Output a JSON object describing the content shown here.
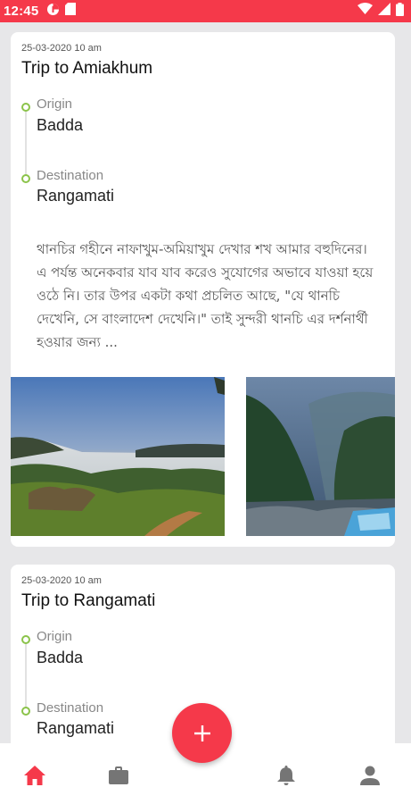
{
  "status_bar": {
    "time": "12:45",
    "left_icons": [
      "data-saver-icon",
      "sd-card-icon"
    ],
    "right_icons": [
      "wifi-icon",
      "signal-icon",
      "battery-icon"
    ],
    "color": "#f5394a"
  },
  "trips": [
    {
      "date": "25-03-2020 10 am",
      "title": "Trip to Amiakhum",
      "origin_label": "Origin",
      "origin": "Badda",
      "destination_label": "Destination",
      "destination": "Rangamati",
      "description": "থানচির গহীনে নাফাখুম-অমিয়াখুম দেখার শখ আমার বহুদিনের। এ পর্যন্ত অনেকবার যাব যাব করেও সুযোগের অভাবে যাওয়া হয়ে ওঠে নি। তার উপর একটা কথা প্রচলিত আছে, \"যে থানচি দেখেনি, সে বাংলাদেশ দেখেনি।\" তাই সুন্দরী থানচি এর দর্শনার্থী হওয়ার জন্য ...",
      "photos": [
        "sunrise-hills-photo",
        "waterfall-forest-photo"
      ]
    },
    {
      "date": "25-03-2020 10 am",
      "title": "Trip to Rangamati",
      "origin_label": "Origin",
      "origin": "Badda",
      "destination_label": "Destination",
      "destination": "Rangamati"
    }
  ],
  "bottom_nav": {
    "items": [
      "home-icon",
      "briefcase-icon",
      "bell-icon",
      "profile-icon"
    ],
    "active": "home-icon",
    "active_color": "#f5394a",
    "inactive_color": "#757575",
    "fab_icon": "plus-icon"
  },
  "timeline_dot_color": "#8bc34a"
}
